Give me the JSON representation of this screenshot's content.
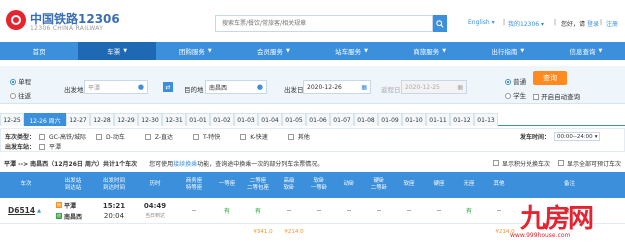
{
  "header": {
    "logo_cn": "中国铁路12306",
    "logo_en": "12306 CHINA RAILWAY",
    "search_placeholder": "搜索车票/餐饮/常旅客/相关规章",
    "lang": "English",
    "my12306": "我的12306",
    "greeting": "您好，请",
    "login": "登录",
    "register": "注册"
  },
  "nav": [
    {
      "label": "首页",
      "dropdown": false
    },
    {
      "label": "车票",
      "dropdown": true,
      "active": true
    },
    {
      "label": "团购服务",
      "dropdown": true
    },
    {
      "label": "会员服务",
      "dropdown": true
    },
    {
      "label": "站车服务",
      "dropdown": true
    },
    {
      "label": "商旅服务",
      "dropdown": true
    },
    {
      "label": "出行指南",
      "dropdown": true
    },
    {
      "label": "信息查询",
      "dropdown": true
    }
  ],
  "form": {
    "one_way": "单程",
    "round_trip": "往返",
    "from_label": "出发地",
    "from_value": "平潭",
    "to_label": "目的地",
    "to_value": "南昌西",
    "depart_label": "出发日",
    "depart_value": "2020-12-26",
    "return_label": "返程日",
    "return_value": "2020-12-25",
    "normal": "普通",
    "student": "学生",
    "query": "查询",
    "auto_query": "开启自动查询"
  },
  "dates": [
    "12-25",
    "12-26 周六",
    "12-27",
    "12-28",
    "12-29",
    "12-30",
    "12-31",
    "01-01",
    "01-02",
    "01-03",
    "01-04",
    "01-05",
    "01-06",
    "01-07",
    "01-08",
    "01-09",
    "01-10",
    "01-11",
    "01-12",
    "01-13"
  ],
  "filter": {
    "type_label": "车次类型：",
    "types": [
      "GC-高铁/城际",
      "D-动车",
      "Z-直达",
      "T-特快",
      "K-快速",
      "其他"
    ],
    "station_label": "出发车站：",
    "stations": [
      "平潭"
    ],
    "time_label": "发车时间：",
    "time_value": "00:00--24:00"
  },
  "result": {
    "route": "平潭 --> 南昌西（12月26日 周六）共计1个车次",
    "notice_prefix": "您可使用",
    "notice_link": "接续换乘",
    "notice_suffix": "功能，查询途中换乘一次的部分列车余票情况。",
    "show_transfer": "显示积分兑换车次",
    "show_all": "显示全部可预订车次"
  },
  "table": {
    "headers": [
      "车次",
      "出发站\n到达站",
      "出发时间\n到达时间",
      "历时",
      "商务座\n特等座",
      "一等座",
      "二等座\n二等包座",
      "高级\n软卧",
      "软卧\n一等卧",
      "动卧",
      "硬卧\n二等卧",
      "软座",
      "硬座",
      "无座",
      "其他",
      "备注"
    ],
    "row": {
      "train": "D6514",
      "from": "平潭",
      "to": "南昌西",
      "dep": "15:21",
      "arr": "20:04",
      "dur": "04:49",
      "dur_note": "当日到达",
      "cells": [
        "--",
        "有",
        "有",
        "--",
        "--",
        "--",
        "--",
        "--",
        "--",
        "有",
        "--",
        "预订"
      ],
      "prices": [
        "",
        "¥341.0",
        "¥214.0",
        "",
        "",
        "",
        "",
        "",
        "",
        "¥214.0",
        "",
        ""
      ]
    }
  },
  "watermark": {
    "text": "九房网",
    "url": "www.999house.com"
  },
  "colors": {
    "primary": "#3b8fdb",
    "accent": "#ff8a1f",
    "brand_red": "#e6242f"
  }
}
